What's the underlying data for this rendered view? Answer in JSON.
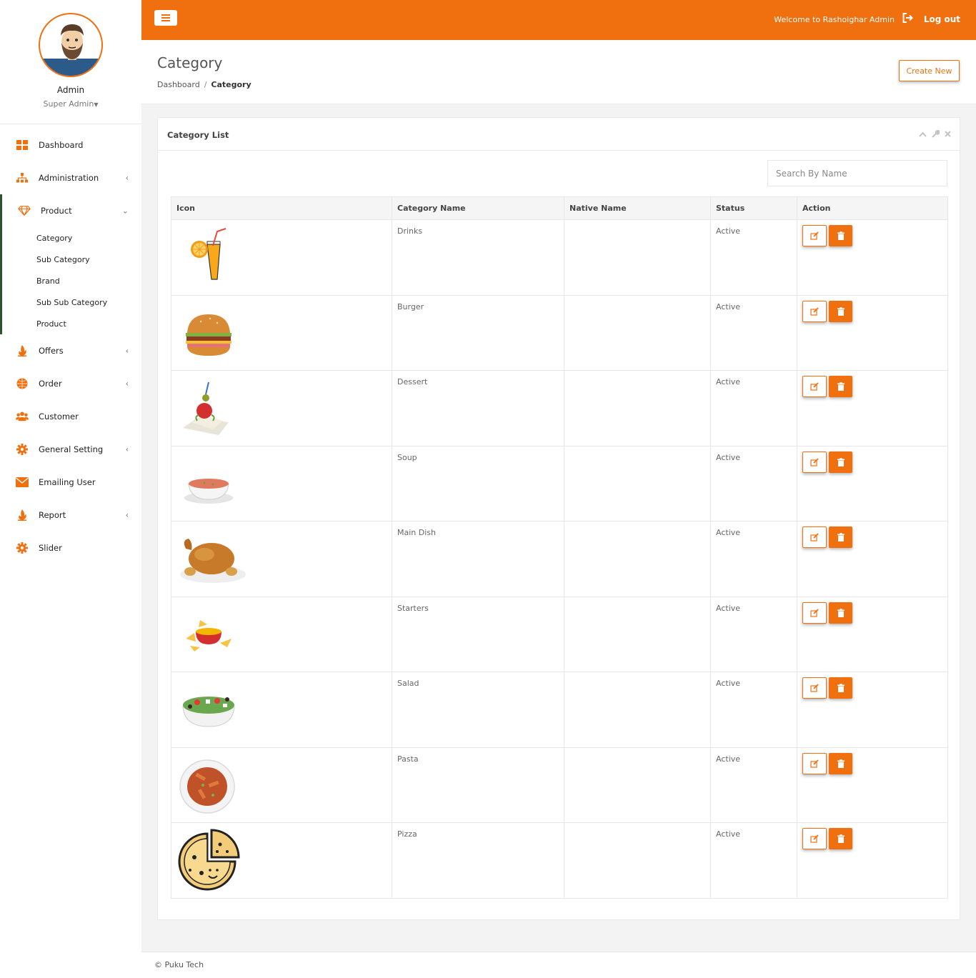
{
  "app": {
    "brand_color": "#f07010",
    "accent_dark": "#2f5233"
  },
  "profile": {
    "name": "Admin",
    "role": "Super Admin",
    "avatar_icon": "bearded-man-avatar"
  },
  "sidebar": {
    "items": [
      {
        "label": "Dashboard",
        "icon": "grid-icon"
      },
      {
        "label": "Administration",
        "icon": "sitemap-icon",
        "has_children": true
      },
      {
        "label": "Product",
        "icon": "diamond-icon",
        "expanded": true
      },
      {
        "label": "Offers",
        "icon": "fire-icon",
        "has_children": true
      },
      {
        "label": "Order",
        "icon": "globe-icon",
        "has_children": true
      },
      {
        "label": "Customer",
        "icon": "users-icon"
      },
      {
        "label": "General Setting",
        "icon": "gear-icon",
        "has_children": true
      },
      {
        "label": "Emailing User",
        "icon": "envelope-icon"
      },
      {
        "label": "Report",
        "icon": "fire-icon",
        "has_children": true
      },
      {
        "label": "Slider",
        "icon": "gear-icon"
      }
    ],
    "product_sub": [
      "Category",
      "Sub Category",
      "Brand",
      "Sub Sub Category",
      "Product"
    ]
  },
  "topbar": {
    "welcome": "Welcome to Rashoighar Admin",
    "logout": "Log out"
  },
  "heading": {
    "title": "Category",
    "breadcrumb": [
      "Dashboard",
      "Category"
    ],
    "create_label": "Create New"
  },
  "panel": {
    "title": "Category List",
    "search_placeholder": "Search By Name"
  },
  "table": {
    "columns": [
      "Icon",
      "Category Name",
      "Native Name",
      "Status",
      "Action"
    ],
    "rows": [
      {
        "icon": "drink-image",
        "name": "Drinks",
        "native": "",
        "status": "Active"
      },
      {
        "icon": "burger-image",
        "name": "Burger",
        "native": "",
        "status": "Active"
      },
      {
        "icon": "dessert-image",
        "name": "Dessert",
        "native": "",
        "status": "Active"
      },
      {
        "icon": "soup-image",
        "name": "Soup",
        "native": "",
        "status": "Active"
      },
      {
        "icon": "roast-chicken-image",
        "name": "Main Dish",
        "native": "",
        "status": "Active"
      },
      {
        "icon": "nachos-image",
        "name": "Starters",
        "native": "",
        "status": "Active"
      },
      {
        "icon": "salad-image",
        "name": "Salad",
        "native": "",
        "status": "Active"
      },
      {
        "icon": "pasta-image",
        "name": "Pasta",
        "native": "",
        "status": "Active"
      },
      {
        "icon": "pizza-image",
        "name": "Pizza",
        "native": "",
        "status": "Active"
      }
    ]
  },
  "footer": {
    "text": "© Puku Tech"
  }
}
